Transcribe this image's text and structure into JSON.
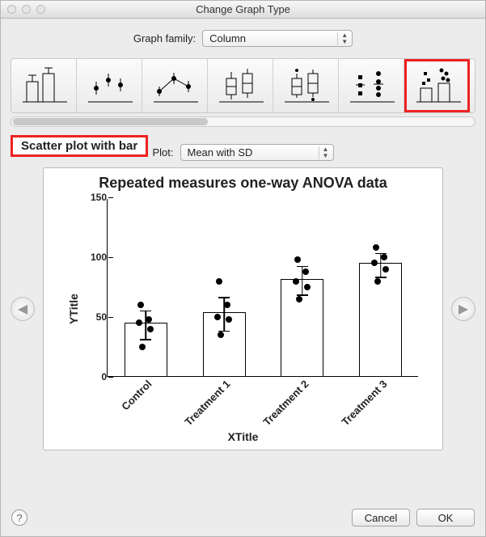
{
  "window": {
    "title": "Change Graph Type"
  },
  "graph_family": {
    "label": "Graph family:",
    "value": "Column"
  },
  "gallery": {
    "selected_index": 6,
    "items": [
      {
        "name": "column-bars-icon"
      },
      {
        "name": "scatter-points-icon"
      },
      {
        "name": "scatter-lines-icon"
      },
      {
        "name": "box-whisker-icon"
      },
      {
        "name": "box-whisker-points-icon"
      },
      {
        "name": "aligned-dots-icon"
      },
      {
        "name": "scatter-with-bar-icon"
      }
    ]
  },
  "selected_type_label": "Scatter plot with bar",
  "plot_select": {
    "label": "Plot:",
    "value": "Mean with SD"
  },
  "preview": {
    "title": "Repeated measures one-way ANOVA data",
    "xtitle": "XTitle",
    "ytitle": "YTitle"
  },
  "chart_data": {
    "type": "bar",
    "title": "Repeated measures one-way ANOVA data",
    "xlabel": "XTitle",
    "ylabel": "YTitle",
    "ylim": [
      0,
      150
    ],
    "yticks": [
      0,
      50,
      100,
      150
    ],
    "categories": [
      "Control",
      "Treatment 1",
      "Treatment 2",
      "Treatment 3"
    ],
    "series": [
      {
        "name": "Mean",
        "values": [
          45,
          54,
          82,
          95
        ],
        "sd": [
          12,
          14,
          12,
          10
        ]
      }
    ],
    "points": {
      "Control": [
        25,
        40,
        45,
        48,
        60
      ],
      "Treatment 1": [
        35,
        48,
        50,
        60,
        80
      ],
      "Treatment 2": [
        65,
        75,
        80,
        88,
        98
      ],
      "Treatment 3": [
        80,
        90,
        95,
        100,
        108
      ]
    }
  },
  "footer": {
    "help_label": "?",
    "cancel": "Cancel",
    "ok": "OK"
  }
}
